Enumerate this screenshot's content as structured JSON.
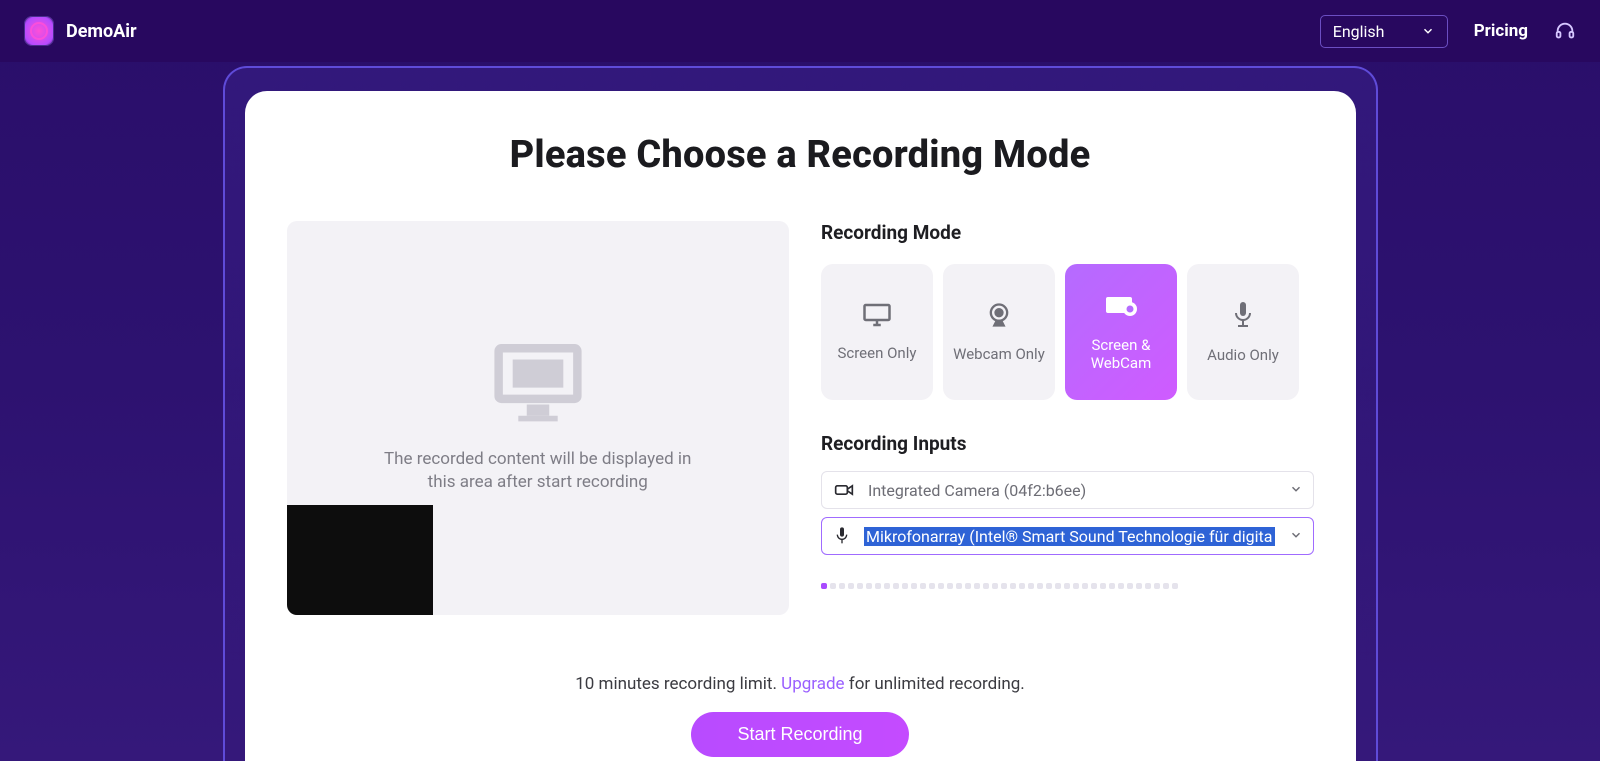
{
  "header": {
    "brand": "DemoAir",
    "language": "English",
    "pricing": "Pricing"
  },
  "title": "Please Choose a Recording Mode",
  "preview": {
    "placeholder_line1": "The recorded content will be displayed in",
    "placeholder_line2": "this area after start recording"
  },
  "sections": {
    "mode_label": "Recording Mode",
    "inputs_label": "Recording Inputs"
  },
  "modes": [
    {
      "label": "Screen Only",
      "icon": "monitor",
      "active": false
    },
    {
      "label": "Webcam Only",
      "icon": "webcam",
      "active": false
    },
    {
      "label": "Screen & WebCam",
      "icon": "screen-webcam",
      "active": true
    },
    {
      "label": "Audio Only",
      "icon": "mic",
      "active": false
    }
  ],
  "inputs": {
    "camera": {
      "value": "Integrated Camera (04f2:b6ee)"
    },
    "microphone": {
      "value": "Mikrofonarray (Intel® Smart Sound Technologie für digita"
    }
  },
  "meter": {
    "segments": 40,
    "active": 1
  },
  "footer": {
    "limit_prefix": "10 minutes recording limit. ",
    "upgrade": "Upgrade",
    "limit_suffix": "  for unlimited recording.",
    "start": "Start Recording"
  }
}
